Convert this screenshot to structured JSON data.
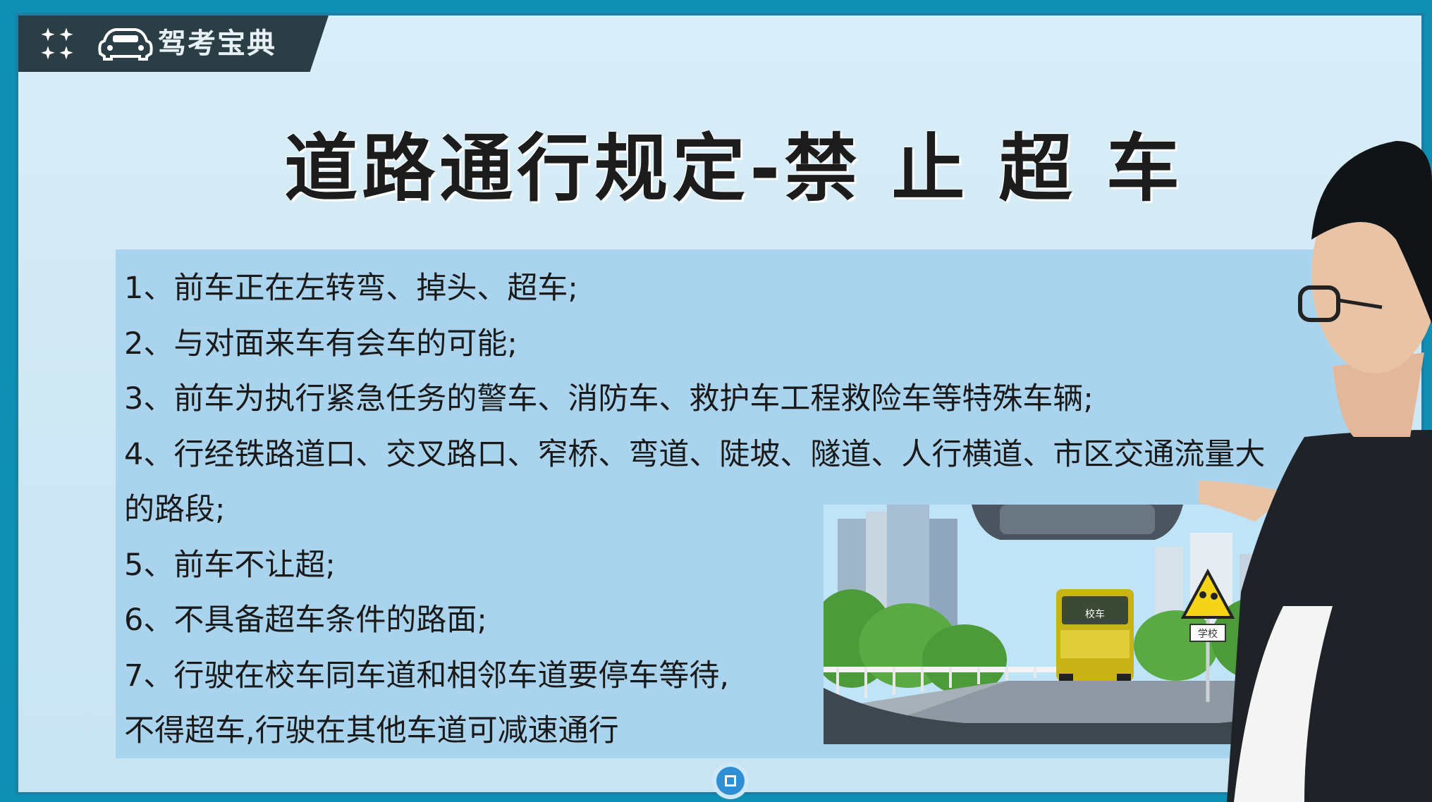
{
  "brand": {
    "name": "驾考宝典",
    "logo_icon": "car-icon",
    "menu_icon": "grid-icon"
  },
  "slide": {
    "title": "道路通行规定-禁 止 超 车",
    "rules": [
      "1、前车正在左转弯、掉头、超车;",
      "2、与对面来车有会车的可能;",
      "3、前车为执行紧急任务的警车、消防车、救护车工程救险车等特殊车辆;",
      "4、行经铁路道口、交叉路口、窄桥、弯道、陡坡、隧道、人行横道、市区交通流量大",
      "的路段;",
      "5、前车不让超;",
      "6、不具备超车条件的路面;",
      "7、行驶在校车同车道和相邻车道要停车等待,",
      "不得超车,行驶在其他车道可减速通行"
    ],
    "illustration": {
      "bus_label": "校车",
      "sign_label": "学校"
    }
  },
  "colors": {
    "accent": "#0f8fb3",
    "panel": "#aad4ee",
    "banner": "#2b3d45"
  }
}
